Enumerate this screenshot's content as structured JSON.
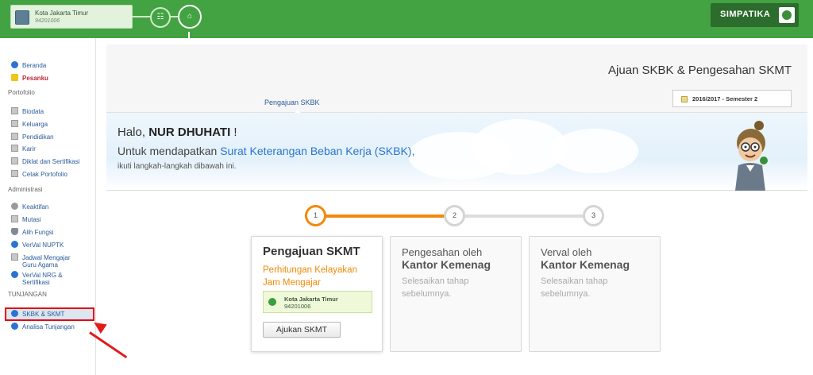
{
  "topbar": {
    "context_title": "Kota Jakarta Timur",
    "context_code": "94201006",
    "brand": "SIMPATIKA"
  },
  "sidebar": {
    "items": [
      {
        "label": "Beranda"
      },
      {
        "label": "Pesanku"
      }
    ],
    "sections": [
      "Portofolio",
      "Administrasi",
      "TUNJANGAN"
    ],
    "portofolio": [
      "Biodata",
      "Keluarga",
      "Pendidikan",
      "Karir",
      "Diklat dan Sertifikasi",
      "Cetak Portofolio"
    ],
    "administrasi": [
      "Keaktifan",
      "Mutasi",
      "Alih Fungsi",
      "VerVal NUPTK",
      "Jadwal Mengajar",
      "Guru Agama",
      "VerVal NRG &",
      "Sertifikasi"
    ],
    "tunjangan": [
      "SKBK & SKMT",
      "Analisa Tunjangan"
    ]
  },
  "header": {
    "title": "Ajuan SKBK & Pengesahan SKMT",
    "tab": "Pengajuan SKBK",
    "semester": "2016/2017 - Semester 2"
  },
  "banner": {
    "hello": "Halo,",
    "name": "NUR DHUHATI",
    "excl": "!",
    "line_pre": "Untuk mendapatkan",
    "line_link": "Surat Keterangan Beban Kerja (SKBK),",
    "line3": "ikuti langkah-langkah dibawah ini."
  },
  "steps": [
    {
      "num": "1",
      "title": "Pengajuan SKMT",
      "sub1": "Perhitungan Kelayakan",
      "sub2": "Jam Mengajar"
    },
    {
      "num": "2",
      "pre": "Pengesahan oleh",
      "title": "Kantor Kemenag",
      "sub1": "Selesaikan tahap",
      "sub2": "sebelumnya."
    },
    {
      "num": "3",
      "pre": "Verval oleh",
      "title": "Kantor Kemenag",
      "sub1": "Selesaikan tahap",
      "sub2": "sebelumnya."
    }
  ],
  "status_box": {
    "title": "Kota Jakarta Timur",
    "code": "94201006"
  },
  "button": "Ajukan SKMT",
  "colors": {
    "primary_green": "#43a342",
    "accent_orange": "#f18a0a",
    "highlight_red": "#e8000d"
  }
}
